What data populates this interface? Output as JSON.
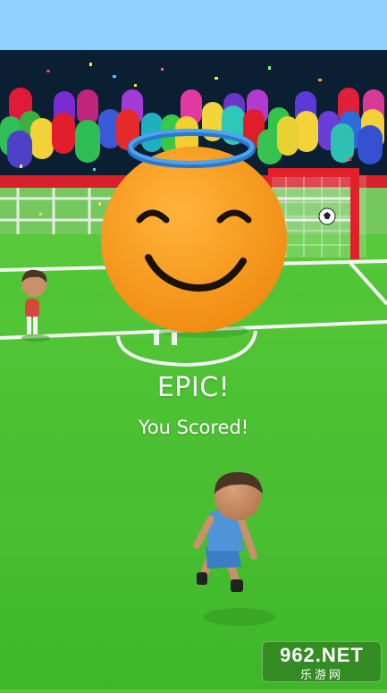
{
  "result": {
    "title": "EPIC!",
    "subtitle": "You Scored!"
  },
  "watermark": {
    "brand": "962.NET",
    "subtext": "乐游网"
  },
  "icons": {
    "emoji": "smiling-angel-emoji-icon",
    "halo": "halo-icon",
    "ball": "soccer-ball-icon"
  },
  "colors": {
    "sky": "#8fd0ff",
    "pitch_light": "#6fdc45",
    "pitch_dark": "#4fbe30",
    "stands": "#0b1f33",
    "emoji_face": "#f79a1f",
    "halo": "#3b8fe0",
    "goal_frame": "#e3202a",
    "player_shirt": "#4f94d8",
    "text": "#ffffff"
  }
}
